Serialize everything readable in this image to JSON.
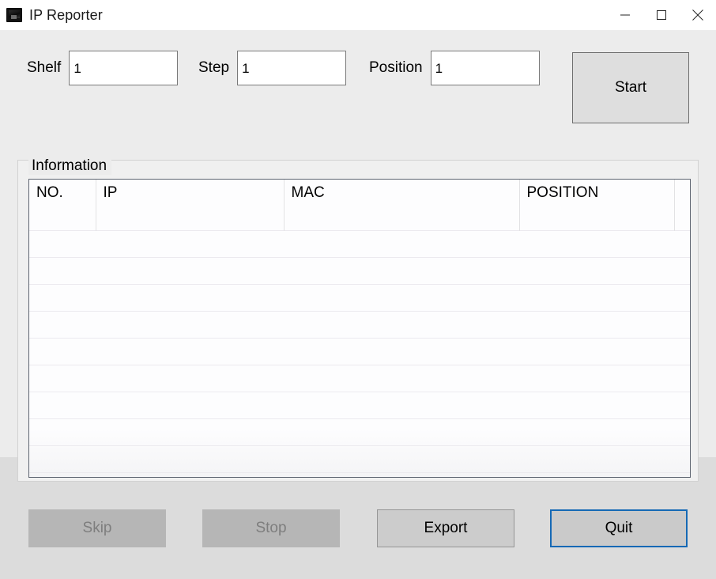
{
  "window": {
    "title": "IP Reporter",
    "icon": "app-icon",
    "controls": [
      {
        "name": "minimize",
        "glyph": "minimize-icon"
      },
      {
        "name": "maximize",
        "glyph": "maximize-icon"
      },
      {
        "name": "close",
        "glyph": "close-icon"
      }
    ]
  },
  "form": {
    "shelf": {
      "label": "Shelf",
      "value": "1",
      "placeholder": ""
    },
    "step": {
      "label": "Step",
      "value": "1",
      "placeholder": ""
    },
    "position": {
      "label": "Position",
      "value": "1",
      "placeholder": ""
    },
    "start_button": "Start"
  },
  "information": {
    "group_title": "Information",
    "columns": [
      "NO.",
      "IP",
      "MAC",
      "POSITION",
      ""
    ],
    "rows": [],
    "empty_row_count": 10
  },
  "actions": {
    "skip": {
      "label": "Skip",
      "enabled": false
    },
    "stop": {
      "label": "Stop",
      "enabled": false
    },
    "export": {
      "label": "Export",
      "enabled": true
    },
    "quit": {
      "label": "Quit",
      "enabled": true,
      "is_default": true
    }
  },
  "colors": {
    "window_background": "#ececec",
    "lower_background": "#dcdcdc",
    "titlebar_background": "#ffffff",
    "text": "#000000",
    "disabled_text": "#7e7e7e",
    "button_face": "#cccccc",
    "default_button_border": "#1569b5",
    "table_border": "#5d6470",
    "grid_line": "#eceaef"
  }
}
